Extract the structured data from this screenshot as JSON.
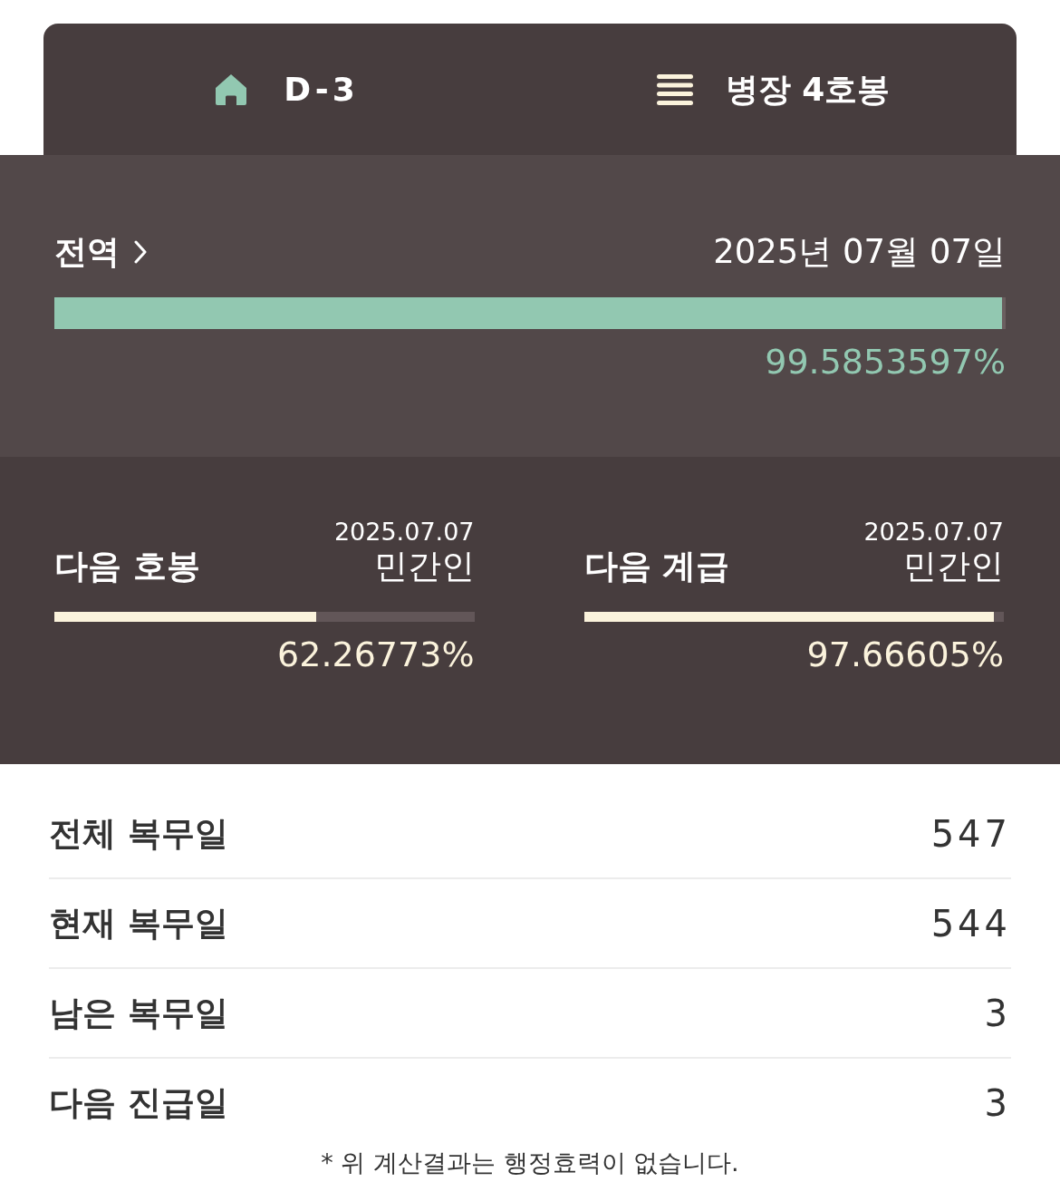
{
  "header": {
    "tabs": [
      {
        "kind": "home",
        "label": "D-3"
      },
      {
        "kind": "menu",
        "label": "병장 4호봉"
      }
    ]
  },
  "discharge": {
    "title": "전역",
    "date": "2025년 07월 07일",
    "level": 0.9958,
    "percent": "99.5853597%"
  },
  "progress": [
    {
      "title": "다음 호봉",
      "date": "2025.07.07",
      "status": "민간인",
      "level": 0.6227,
      "percent": "62.26773%"
    },
    {
      "title": "다음 계급",
      "date": "2025.07.07",
      "status": "민간인",
      "level": 0.9767,
      "percent": "97.66605%"
    }
  ],
  "stats": [
    {
      "label": "전체 복무일",
      "value": "547"
    },
    {
      "label": "현재 복무일",
      "value": "544"
    },
    {
      "label": "남은 복무일",
      "value": "3"
    },
    {
      "label": "다음 진급일",
      "value": "3"
    }
  ],
  "note": "* 위 계산결과는 행정효력이 없습니다."
}
